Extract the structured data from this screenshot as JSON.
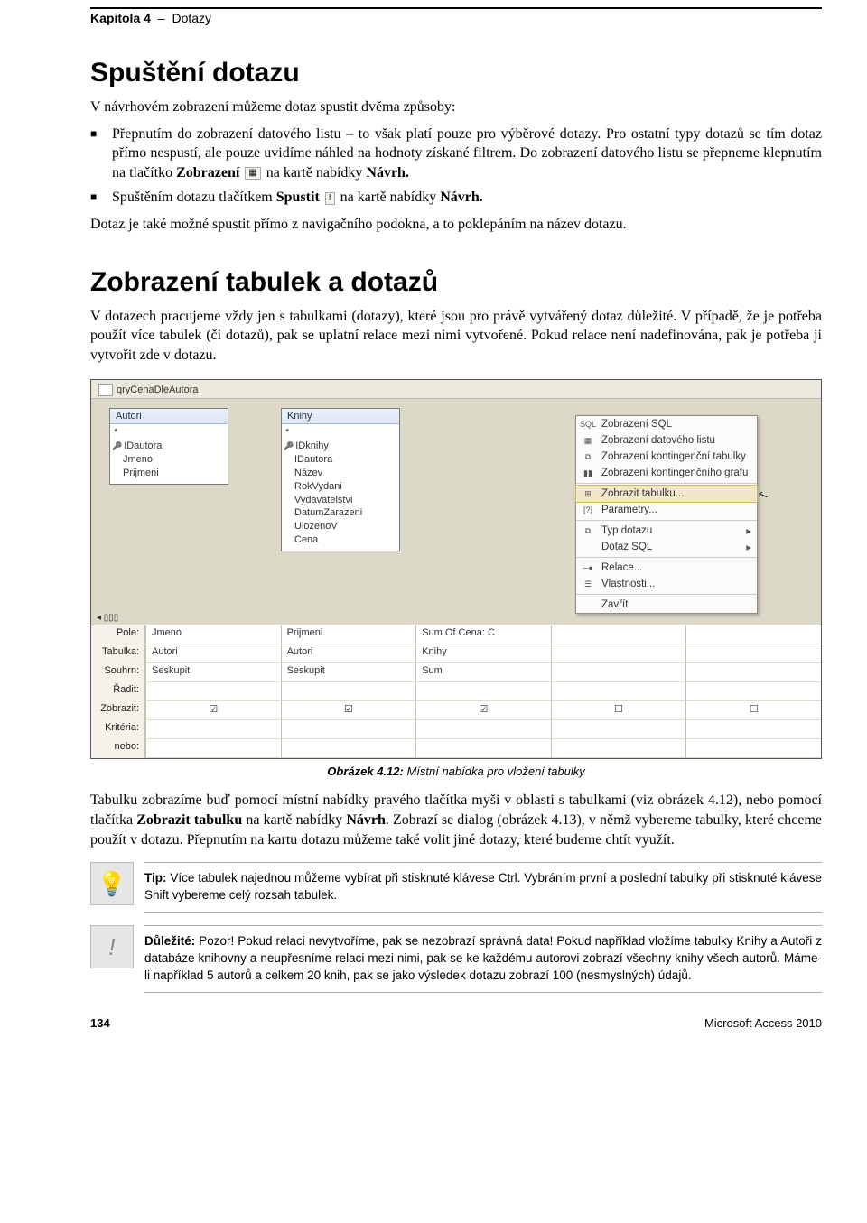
{
  "header": {
    "chapter": "Kapitola 4",
    "sep": "–",
    "title": "Dotazy"
  },
  "h1a": "Spuštění dotazu",
  "p1": "V návrhovém zobrazení můžeme dotaz spustit dvěma způsoby:",
  "bul1a": "Přepnutím do zobrazení datového listu – to však platí pouze pro výběrové dotazy. Pro ostatní typy dotazů se tím dotaz přímo nespustí, ale pouze uvidíme náhled na hodnoty získané filtrem. Do zobrazení datového listu se přepneme klepnutím na tlačítko ",
  "bul1b": "Zobrazení",
  "bul1c": " na kartě nabídky ",
  "bul1d": "Návrh.",
  "bul2a": "Spuštěním dotazu tlačítkem ",
  "bul2b": "Spustit",
  "bul2c": " na kartě nabídky ",
  "bul2d": "Návrh.",
  "p2": "Dotaz je také možné spustit přímo z navigačního podokna, a to poklepáním na název dotazu.",
  "h1b": "Zobrazení tabulek a dotazů",
  "p3": "V dotazech pracujeme vždy jen s tabulkami (dotazy), které jsou pro právě vytvářený dotaz důležité. V případě, že je potřeba použít více tabulek (či dotazů), pak se uplatní relace mezi nimi vytvořené. Pokud relace není nadefinována, pak je potřeba ji vytvořit zde v dotazu.",
  "figure": {
    "tab": "qryCenaDleAutora",
    "tables": {
      "autori": {
        "title": "Autori",
        "star": "*",
        "fields": [
          "IDautora",
          "Jmeno",
          "Prijmeni"
        ]
      },
      "knihy": {
        "title": "Knihy",
        "star": "*",
        "fields": [
          "IDknihy",
          "IDautora",
          "Název",
          "RokVydani",
          "Vydavatelstvi",
          "DatumZarazeni",
          "UlozenoV",
          "Cena"
        ]
      }
    },
    "menu": {
      "sql": "Zobrazení SQL",
      "datasheet": "Zobrazení datového listu",
      "pivot": "Zobrazení kontingenční tabulky",
      "chart": "Zobrazení kontingenčního grafu",
      "show_table": "Zobrazit tabulku...",
      "params": "Parametry...",
      "qtype": "Typ dotazu",
      "sqlq": "Dotaz SQL",
      "relations": "Relace...",
      "props": "Vlastnosti...",
      "close": "Zavřít"
    },
    "grid": {
      "labels": {
        "field": "Pole:",
        "table": "Tabulka:",
        "total": "Souhrn:",
        "sort": "Řadit:",
        "show": "Zobrazit:",
        "criteria": "Kritéria:",
        "or": "nebo:"
      },
      "cols": [
        {
          "field": "Jmeno",
          "table": "Autori",
          "total": "Seskupit",
          "show": true
        },
        {
          "field": "Prijmeni",
          "table": "Autori",
          "total": "Seskupit",
          "show": true
        },
        {
          "field": "Sum Of Cena: C",
          "table": "Knihy",
          "total": "Sum",
          "show": true
        },
        {
          "field": "",
          "table": "",
          "total": "",
          "show": false
        },
        {
          "field": "",
          "table": "",
          "total": "",
          "show": false
        }
      ]
    }
  },
  "caption_bold": "Obrázek 4.12:",
  "caption_text": " Místní nabídka pro vložení tabulky",
  "p4a": "Tabulku zobrazíme buď pomocí místní nabídky pravého tlačítka myši v oblasti s tabulkami (viz obrázek 4.12), nebo pomocí tlačítka ",
  "p4b": "Zobrazit tabulku",
  "p4c": " na kartě nabídky ",
  "p4d": "Návrh",
  "p4e": ". Zobrazí se dialog (obrázek 4.13), v němž vybereme tabulky, které chceme použít v dotazu. Přepnutím na kartu dotazu můžeme také volit jiné dotazy, které budeme chtít využít.",
  "tip_label": "Tip:",
  "tip_text": " Více tabulek najednou můžeme vybírat při stisknuté klávese Ctrl. Vybráním první a poslední tabulky při stisknuté klávese Shift vybereme celý rozsah tabulek.",
  "imp_label": "Důležité:",
  "imp_text": " Pozor! Pokud relaci nevytvoříme, pak se nezobrazí správná data! Pokud například vložíme tabulky Knihy a Autoři z databáze knihovny a neupřesníme relaci mezi nimi, pak se ke každému autorovi zobrazí všechny knihy všech autorů. Máme-li například 5 autorů a celkem 20 knih, pak se jako výsledek dotazu zobrazí 100 (nesmyslných) údajů.",
  "foot": {
    "page": "134",
    "product": "Microsoft Access 2010"
  }
}
